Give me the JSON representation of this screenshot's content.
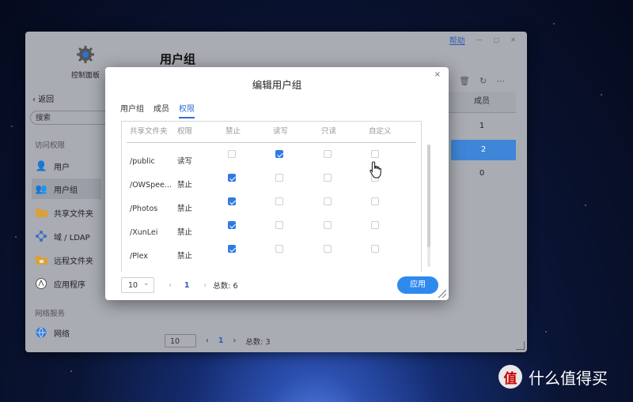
{
  "window": {
    "help": "帮助"
  },
  "sidebar": {
    "control_panel": "控制面板",
    "back": "返回",
    "search_placeholder": "搜索",
    "section_access": "访问权限",
    "section_network": "网络服务",
    "items": [
      {
        "label": "用户",
        "icon": "user-icon"
      },
      {
        "label": "用户组",
        "icon": "user-group-icon"
      },
      {
        "label": "共享文件夹",
        "icon": "folder-icon"
      },
      {
        "label": "域 / LDAP",
        "icon": "domain-icon"
      },
      {
        "label": "远程文件夹",
        "icon": "remote-folder-icon"
      },
      {
        "label": "应用程序",
        "icon": "app-icon"
      }
    ],
    "network_items": [
      {
        "label": "网络",
        "icon": "globe-icon"
      }
    ]
  },
  "main": {
    "title": "用户组",
    "table": {
      "header": "成员",
      "values": [
        "1",
        "2",
        "0"
      ],
      "selected_index": 1
    },
    "pager": {
      "page_size": "10",
      "page": "1",
      "total": "总数: 3"
    }
  },
  "dialog": {
    "title": "编辑用户组",
    "close": "×",
    "tabs": [
      "用户组",
      "成员",
      "权限"
    ],
    "active_tab": 2,
    "columns": [
      "共享文件夹",
      "权限",
      "禁止",
      "读写",
      "只读",
      "自定义"
    ],
    "rows": [
      {
        "folder": "/public",
        "perm": "读写",
        "checks": [
          false,
          true,
          false,
          false
        ]
      },
      {
        "folder": "/OWSpee...",
        "perm": "禁止",
        "checks": [
          true,
          false,
          false,
          false
        ]
      },
      {
        "folder": "/Photos",
        "perm": "禁止",
        "checks": [
          true,
          false,
          false,
          false
        ]
      },
      {
        "folder": "/XunLei",
        "perm": "禁止",
        "checks": [
          true,
          false,
          false,
          false
        ]
      },
      {
        "folder": "/Plex",
        "perm": "禁止",
        "checks": [
          true,
          false,
          false,
          false
        ]
      }
    ],
    "pager": {
      "page_size": "10",
      "prev": "‹",
      "page": "1",
      "next": "›",
      "total": "总数: 6"
    },
    "apply": "应用"
  },
  "watermark": {
    "badge": "值",
    "text": "什么值得买"
  },
  "colors": {
    "accent": "#2f8aed",
    "checked": "#2f7be0",
    "selected_row": "#3f86d8"
  }
}
